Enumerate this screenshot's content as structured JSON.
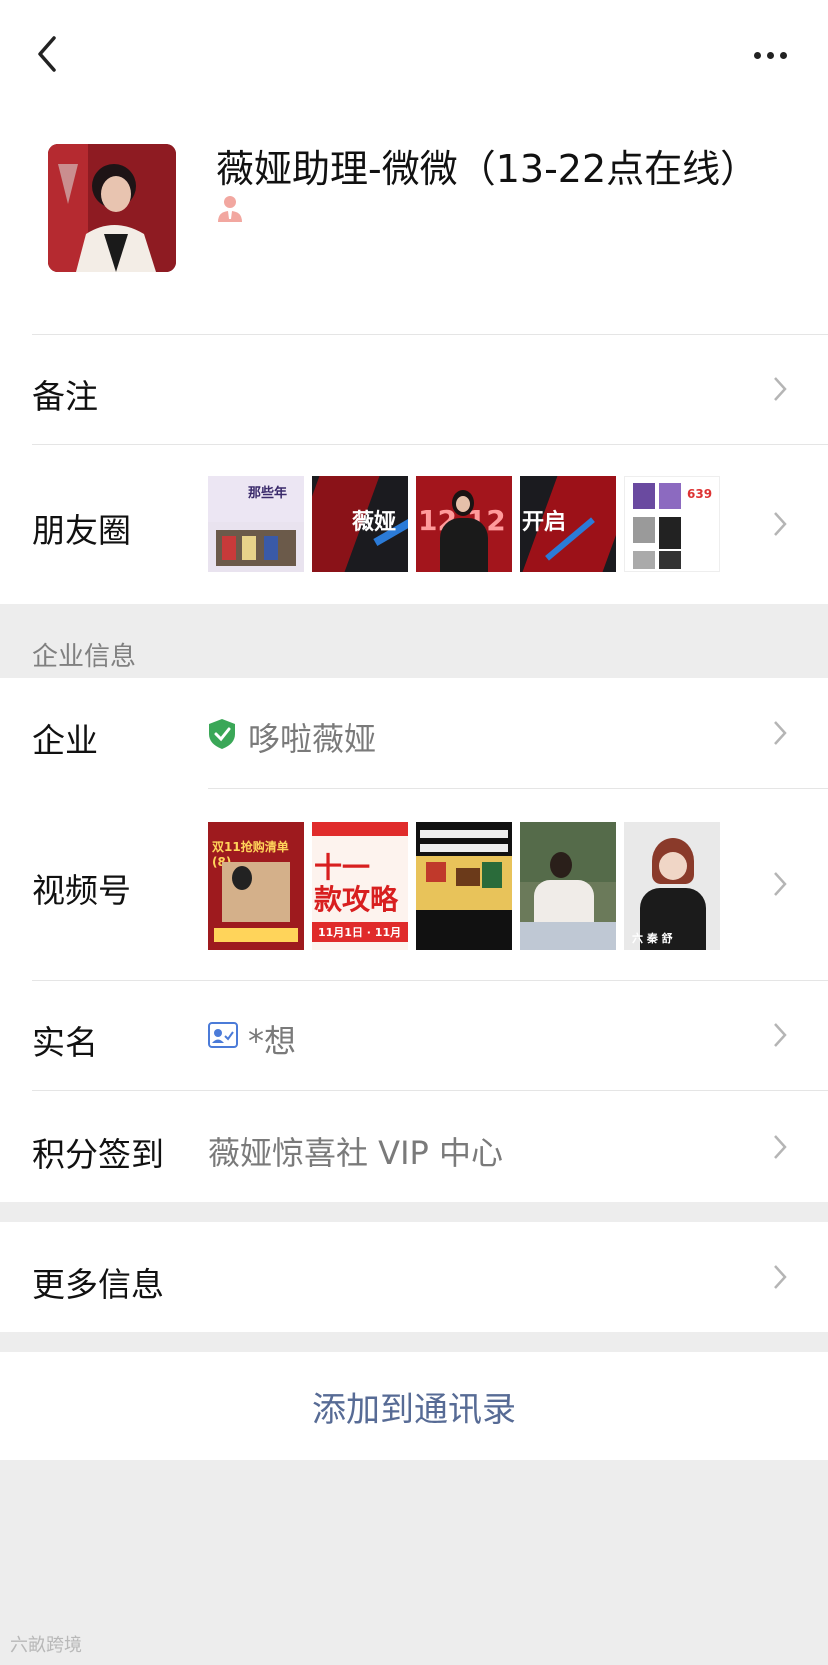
{
  "header": {
    "back_icon": "chevron-left-icon",
    "more_icon": "more-dots-icon"
  },
  "profile": {
    "name": "薇娅助理-微微（13-22点在线）",
    "work_icon": "enterprise-person-icon"
  },
  "rows": {
    "remark": {
      "label": "备注"
    },
    "moments": {
      "label": "朋友圈",
      "thumb_texts": [
        "那些年",
        "薇娅",
        "12 12",
        "开启",
        "639"
      ]
    },
    "enterprise_section": "企业信息",
    "company": {
      "label": "企业",
      "value": "哆啦薇娅",
      "icon": "verified-shield-icon"
    },
    "channels": {
      "label": "视频号",
      "thumb_texts": [
        "双11抢购清单(8)",
        "十一 款攻略",
        "11月1日 · 11月",
        "",
        "六 秦 舒"
      ]
    },
    "realname": {
      "label": "实名",
      "value": "*想",
      "icon": "id-card-icon"
    },
    "points": {
      "label": "积分签到",
      "value": "薇娅惊喜社 VIP 中心"
    },
    "more_info": {
      "label": "更多信息"
    }
  },
  "actions": {
    "add_contact": "添加到通讯录"
  },
  "watermark": "六畝跨境",
  "colors": {
    "link_blue": "#576b95",
    "verified_green": "#3aa757"
  }
}
